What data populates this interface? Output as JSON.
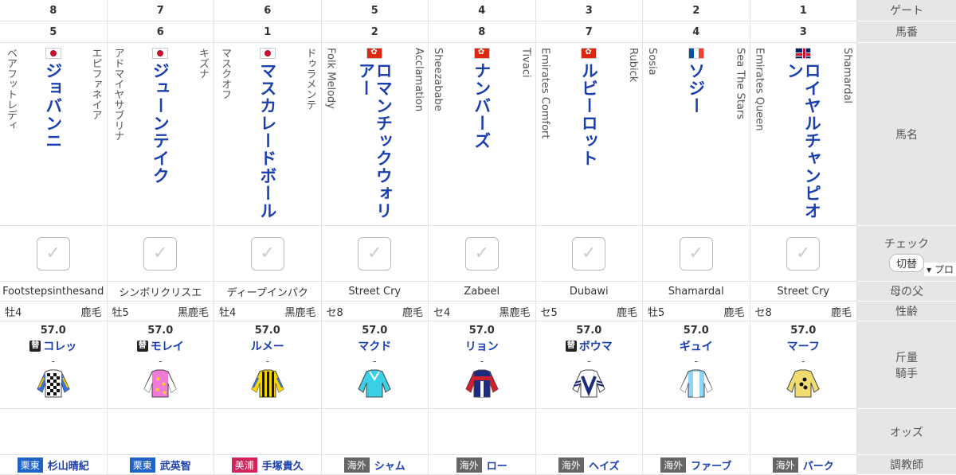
{
  "header_labels": {
    "gate": "ゲート",
    "horse_number": "馬番",
    "horse_name": "馬名",
    "check": "チェック",
    "toggle": "切替",
    "pro": "▾ プロ",
    "dam_sire": "母の父",
    "sex_age": "性齢",
    "weight_jockey_1": "斤量",
    "weight_jockey_2": "騎手",
    "odds": "オッズ",
    "trainer": "調教師"
  },
  "entries": [
    {
      "gate": "8",
      "number": "5",
      "sire": "エピファネイア",
      "dam": "ベアフットレディ",
      "flag": "jp",
      "name": "ジョバンニ",
      "dam_sire": "Footstepsinthesand",
      "sex": "牡4",
      "coat": "鹿毛",
      "weight": "57.0",
      "sub": true,
      "jockey": "コレッ",
      "dash": "-",
      "trainer_region": "栗東",
      "trainer_color": "#1f63c6",
      "trainer": "杉山晴紀"
    },
    {
      "gate": "7",
      "number": "6",
      "sire": "キズナ",
      "dam": "アドマイヤサブリナ",
      "flag": "jp",
      "name": "ジューンテイク",
      "dam_sire": "シンボリクリスエ",
      "sex": "牡5",
      "coat": "黒鹿毛",
      "weight": "57.0",
      "sub": true,
      "jockey": "モレイ",
      "dash": "-",
      "trainer_region": "栗東",
      "trainer_color": "#1f63c6",
      "trainer": "武英智"
    },
    {
      "gate": "6",
      "number": "1",
      "sire": "ドゥラメンテ",
      "dam": "マスクオフ",
      "flag": "jp",
      "name": "マスカレードボール",
      "dam_sire": "ディープインパク",
      "sex": "牡4",
      "coat": "黒鹿毛",
      "weight": "57.0",
      "sub": false,
      "jockey": "ルメー",
      "dash": "-",
      "trainer_region": "美浦",
      "trainer_color": "#d0245a",
      "trainer": "手塚貴久"
    },
    {
      "gate": "5",
      "number": "2",
      "sire": "Acclamation",
      "dam": "Folk Melody",
      "flag": "hk",
      "name": "ロマンチックウォリアー",
      "dam_sire": "Street Cry",
      "sex": "セ8",
      "coat": "鹿毛",
      "weight": "57.0",
      "sub": false,
      "jockey": "マクド",
      "dash": "-",
      "trainer_region": "海外",
      "trainer_color": "#666666",
      "trainer": "シャム"
    },
    {
      "gate": "4",
      "number": "8",
      "sire": "Tivaci",
      "dam": "Sheezababe",
      "flag": "hk",
      "name": "ナンバーズ",
      "dam_sire": "Zabeel",
      "sex": "セ4",
      "coat": "黒鹿毛",
      "weight": "57.0",
      "sub": false,
      "jockey": "リョン",
      "dash": "-",
      "trainer_region": "海外",
      "trainer_color": "#666666",
      "trainer": "ロー"
    },
    {
      "gate": "3",
      "number": "7",
      "sire": "Rubick",
      "dam": "Emirates Comfort",
      "flag": "hk",
      "name": "ルビーロット",
      "dam_sire": "Dubawi",
      "sex": "セ5",
      "coat": "鹿毛",
      "weight": "57.0",
      "sub": true,
      "jockey": "ボウマ",
      "dash": "-",
      "trainer_region": "海外",
      "trainer_color": "#666666",
      "trainer": "ヘイズ"
    },
    {
      "gate": "2",
      "number": "4",
      "sire": "Sea The Stars",
      "dam": "Sosia",
      "flag": "fr",
      "name": "ソジー",
      "dam_sire": "Shamardal",
      "sex": "牡5",
      "coat": "鹿毛",
      "weight": "57.0",
      "sub": false,
      "jockey": "ギュイ",
      "dash": "-",
      "trainer_region": "海外",
      "trainer_color": "#666666",
      "trainer": "ファーブ"
    },
    {
      "gate": "1",
      "number": "3",
      "sire": "Shamardal",
      "dam": "Emirates Queen",
      "flag": "gb",
      "name": "ロイヤルチャンピオン",
      "dam_sire": "Street Cry",
      "sex": "セ8",
      "coat": "鹿毛",
      "weight": "57.0",
      "sub": false,
      "jockey": "マーフ",
      "dash": "-",
      "trainer_region": "海外",
      "trainer_color": "#666666",
      "trainer": "パーク"
    }
  ],
  "sub_mark": "替",
  "check_mark": "✓"
}
